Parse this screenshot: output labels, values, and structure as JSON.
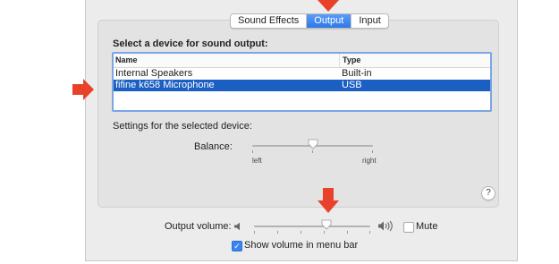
{
  "tabs": [
    {
      "label": "Sound Effects",
      "active": false
    },
    {
      "label": "Output",
      "active": true
    },
    {
      "label": "Input",
      "active": false
    }
  ],
  "output": {
    "section_title": "Select a device for sound output:",
    "columns": [
      "Name",
      "Type"
    ],
    "devices": [
      {
        "name": "Internal Speakers",
        "type": "Built-in",
        "selected": false
      },
      {
        "name": "fifine k658 Microphone",
        "type": "USB",
        "selected": true
      }
    ],
    "settings_label": "Settings for the selected device:",
    "balance": {
      "label": "Balance:",
      "left_label": "left",
      "right_label": "right",
      "value": 0.5
    },
    "help_label": "?"
  },
  "volume": {
    "label": "Output volume:",
    "value": 0.62,
    "mute_label": "Mute",
    "mute_checked": false,
    "menu_bar_label": "Show volume in menu bar",
    "menu_bar_checked": true
  },
  "colors": {
    "accent": "#2f78e6",
    "selection": "#1c5fc2",
    "annotation_arrow": "#e8432a"
  },
  "icons": [
    "speaker-low-icon",
    "speaker-high-icon",
    "checkmark-icon",
    "help-icon",
    "red-arrow-annotation"
  ]
}
